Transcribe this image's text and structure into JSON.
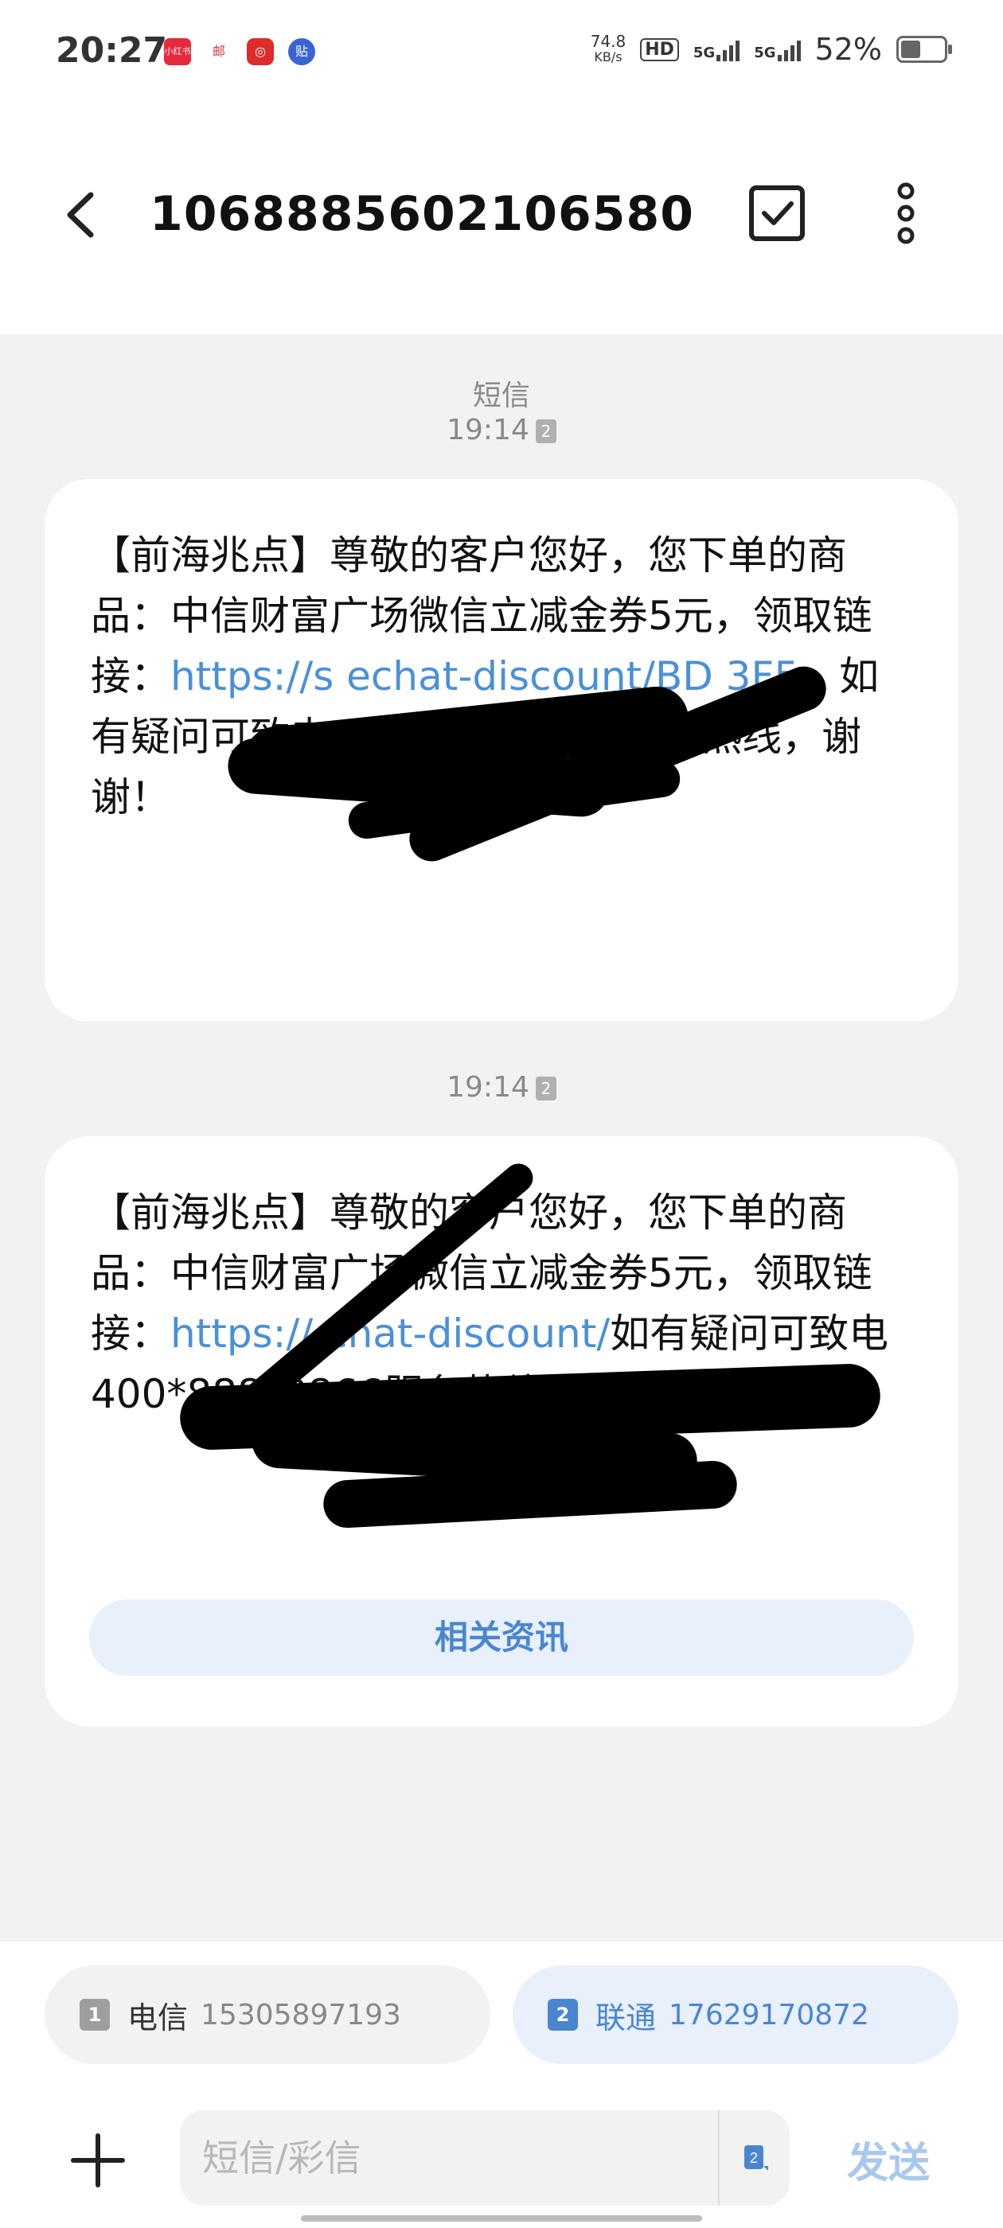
{
  "status_bar": {
    "time": "20:27",
    "apps": [
      {
        "icon": "xiaohongshu-icon",
        "text": "小红书",
        "color": "#e8283b"
      },
      {
        "icon": "postal-icon",
        "text": "邮",
        "color": "#ffffff"
      },
      {
        "icon": "netease-music-icon",
        "text": "◎",
        "color": "#e02b2b"
      },
      {
        "icon": "tieba-icon",
        "text": "贴",
        "color": "#ffffff"
      }
    ],
    "net_speed": "74.8",
    "net_unit": "KB/s",
    "hd": "HD",
    "sim1": "5G",
    "sim2": "5G",
    "battery": "52%",
    "battery_level": 0.52
  },
  "header": {
    "title": "1068885602106580",
    "back_icon": "back-arrow-icon",
    "select_icon": "checkbox-icon",
    "more_icon": "more-vertical-icon"
  },
  "conversation": {
    "type_label": "短信",
    "messages": [
      {
        "time": "19:14",
        "sim": "2",
        "text_before": "【前海兆点】尊敬的客户您好，您下单的商品：中信财富广场微信立减金券5元，领取链接：",
        "link": "https://s                          echat-discount/BD                        3F5",
        "text_after": "。如有疑问可致电400*888*0866服务热线，谢谢！"
      },
      {
        "time": "19:14",
        "sim": "2",
        "text_before": "【前海兆点】尊敬的客户您好，您下单的商品：中信财富广场微信立减金券5元，领取链接：",
        "link": "https://                          chat-discount/",
        "text_after": "如有疑问可致电400*888*0866服务热线，谢谢！",
        "action_label": "相关资讯"
      }
    ]
  },
  "compose": {
    "sim_options": [
      {
        "index": "1",
        "carrier": "电信",
        "number": "15305897193",
        "selected": false
      },
      {
        "index": "2",
        "carrier": "联通",
        "number": "17629170872",
        "selected": true
      }
    ],
    "placeholder": "短信/彩信",
    "send_label": "发送",
    "sim_switch_badge": "2"
  },
  "colors": {
    "accent": "#4a86d0",
    "link": "#4a90d9",
    "selected_sim_bg": "#e8f0fb",
    "background": "#f2f2f2"
  }
}
